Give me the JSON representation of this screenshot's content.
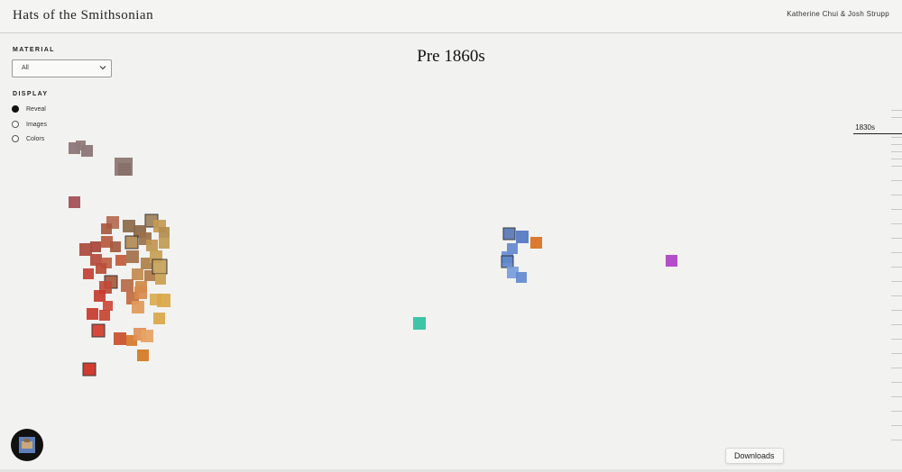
{
  "header": {
    "title": "Hats of the Smithsonian",
    "authors": "Katherine Chui & Josh Strupp"
  },
  "era": {
    "title": "Pre 1860s"
  },
  "controls": {
    "material_label": "MATERIAL",
    "material_value": "All",
    "display_label": "DISPLAY",
    "display_options": [
      {
        "label": "Reveal",
        "selected": true
      },
      {
        "label": "Images",
        "selected": false
      },
      {
        "label": "Colors",
        "selected": false
      }
    ]
  },
  "timeline": {
    "current_decade": "1830s"
  },
  "downloads": {
    "label": "Downloads"
  },
  "icons": {
    "chevron": "chevron-down-icon",
    "avatar": "hat-thumbnail-icon"
  },
  "colors": {
    "background": "#f2f2f0",
    "reds": "#c9372a",
    "browns": "#8b5a3c",
    "golds": "#c89a45",
    "blues": "#5b82c4",
    "orange": "#d9711f",
    "teal": "#2fc0a0",
    "purple": "#b03fc8"
  }
}
